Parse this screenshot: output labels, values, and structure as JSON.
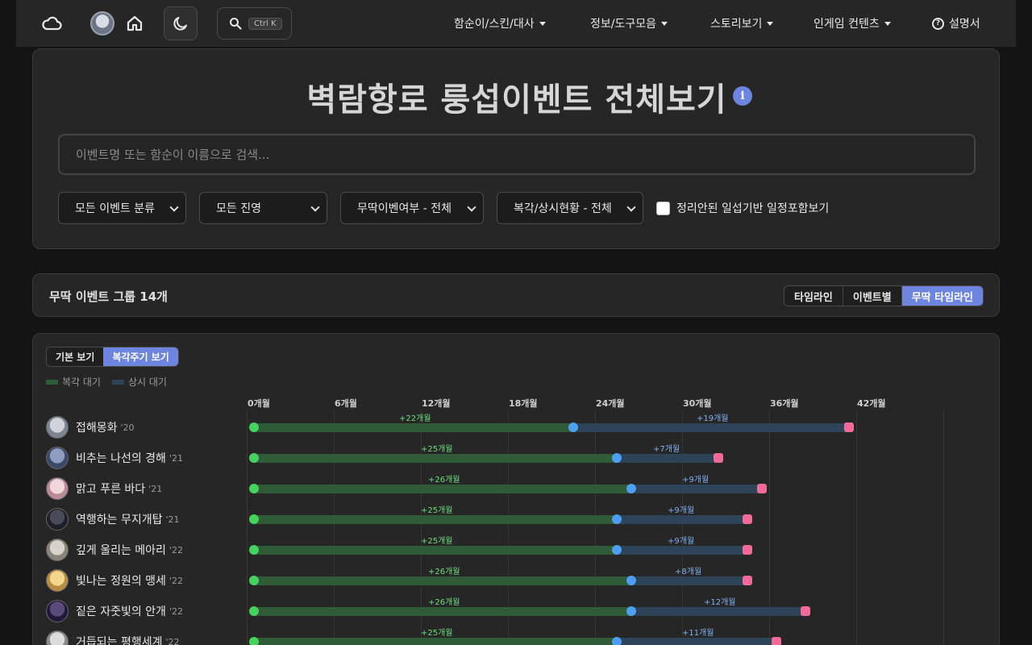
{
  "nav": {
    "search_shortcut": "Ctrl K",
    "menus": [
      "함순이/스킨/대사",
      "정보/도구모음",
      "스토리보기",
      "인게임 컨텐츠"
    ],
    "help_label": "설명서"
  },
  "header": {
    "title": "벽람항로 룽섭이벤트 전체보기",
    "search_placeholder": "이벤트명 또는 함순이 이름으로 검색..."
  },
  "filters": {
    "category": "모든 이벤트 분류",
    "faction": "모든 진영",
    "free": "무딱이벤여부 - 전체",
    "rerun": "복각/상시현황 - 전체",
    "checkbox_label": "정리안된 일섭기반 일정포함보기"
  },
  "group_bar": {
    "label": "무딱 이벤트 그룹 14개",
    "views": [
      "타임라인",
      "이벤트별",
      "무딱 타임라인"
    ],
    "active_view": 2
  },
  "timeline": {
    "modes": [
      "기본 보기",
      "복각주기 보기"
    ],
    "active_mode": 1,
    "legend": [
      {
        "label": "복각 대기",
        "color": "#2f5b38"
      },
      {
        "label": "상시 대기",
        "color": "#2c4358"
      }
    ],
    "colors": {
      "rerun": "#2f5b38",
      "perm": "#2c4358",
      "start": "#45d35e",
      "mid": "#4f9ff0",
      "end": "#f06b9a"
    }
  },
  "chart_data": {
    "type": "bar",
    "xlabel": "",
    "x_ticks": [
      "0개월",
      "6개월",
      "12개월",
      "18개월",
      "24개월",
      "30개월",
      "36개월",
      "42개월"
    ],
    "xlim": [
      0,
      48
    ],
    "events": [
      {
        "name": "접해몽화",
        "year": "'20",
        "rerun_months": 22,
        "rerun_label": "+22개월",
        "perm_months": 19,
        "perm_label": "+19개월"
      },
      {
        "name": "비추는 나선의 경해",
        "year": "'21",
        "rerun_months": 25,
        "rerun_label": "+25개월",
        "perm_months": 7,
        "perm_label": "+7개월"
      },
      {
        "name": "맑고 푸른 바다",
        "year": "'21",
        "rerun_months": 26,
        "rerun_label": "+26개월",
        "perm_months": 9,
        "perm_label": "+9개월"
      },
      {
        "name": "역행하는 무지개탑",
        "year": "'21",
        "rerun_months": 25,
        "rerun_label": "+25개월",
        "perm_months": 9,
        "perm_label": "+9개월"
      },
      {
        "name": "깊게 울리는 메아리",
        "year": "'22",
        "rerun_months": 25,
        "rerun_label": "+25개월",
        "perm_months": 9,
        "perm_label": "+9개월"
      },
      {
        "name": "빛나는 정원의 맹세",
        "year": "'22",
        "rerun_months": 26,
        "rerun_label": "+26개월",
        "perm_months": 8,
        "perm_label": "+8개월"
      },
      {
        "name": "짙은 자줏빛의 안개",
        "year": "'22",
        "rerun_months": 26,
        "rerun_label": "+26개월",
        "perm_months": 12,
        "perm_label": "+12개월"
      },
      {
        "name": "거듭되는 평행세계",
        "year": "'22",
        "rerun_months": 25,
        "rerun_label": "+25개월",
        "perm_months": 11,
        "perm_label": "+11개월"
      }
    ]
  }
}
